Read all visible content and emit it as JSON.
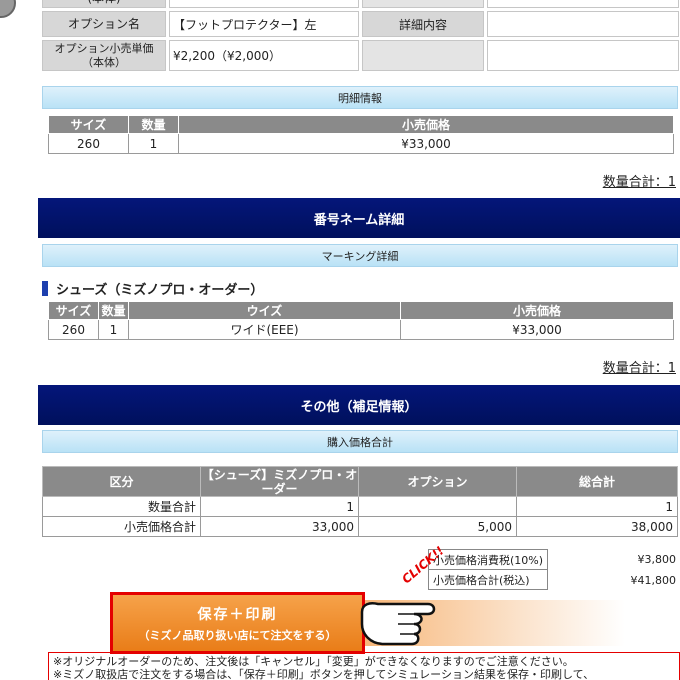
{
  "top_rows": [
    {
      "label1": "(本体)",
      "value1": "",
      "label2": "",
      "value2": ""
    },
    {
      "label1": "オプション名",
      "value1": "【フットプロテクター】左",
      "label2": "詳細内容",
      "value2": ""
    },
    {
      "label1": "オプション小売単価\n（本体）",
      "value1": "¥2,200（¥2,000）",
      "label2": "",
      "value2": ""
    }
  ],
  "meisai": {
    "title": "明細情報",
    "headers": [
      "サイズ",
      "数量",
      "小売価格"
    ],
    "rows": [
      [
        "260",
        "1",
        "¥33,000"
      ]
    ],
    "qty_total": "数量合計：1"
  },
  "bango": {
    "title": "番号ネーム詳細",
    "marking_title": "マーキング詳細",
    "shoe_title": "シューズ（ミズノプロ・オーダー）",
    "headers": [
      "サイズ",
      "数量",
      "ウイズ",
      "小売価格"
    ],
    "rows": [
      [
        "260",
        "1",
        "ワイド(EEE)",
        "¥33,000"
      ]
    ],
    "qty_total": "数量合計：1"
  },
  "sonota": {
    "title": "その他（補足情報）",
    "purchase_title": "購入価格合計",
    "headers": [
      "区分",
      "【シューズ】ミズノプロ・オーダー",
      "オプション",
      "総合計"
    ],
    "rows": [
      [
        "数量合計",
        "1",
        "",
        "1"
      ],
      [
        "小売価格合計",
        "33,000",
        "5,000",
        "38,000"
      ]
    ]
  },
  "tax": [
    {
      "label": "小売価格消費税(10%)",
      "value": "¥3,800"
    },
    {
      "label": "小売価格合計(税込)",
      "value": "¥41,800"
    }
  ],
  "save_button": {
    "main": "保存＋印刷",
    "sub": "（ミズノ品取り扱い店にて注文をする）"
  },
  "click_label": "CLICK!!",
  "notes": [
    "※オリジナルオーダーのため、注文後は「キャンセル」「変更」ができなくなりますのでご注意ください。",
    "※ミズノ取扱店で注文をする場合は、「保存＋印刷」ボタンを押してシミュレーション結果を保存・印刷して、"
  ],
  "colors": {
    "navy": "#04167a",
    "accent_red": "#e40000",
    "button_orange": "#e97d18",
    "light_blue": "#b9e2f6"
  }
}
